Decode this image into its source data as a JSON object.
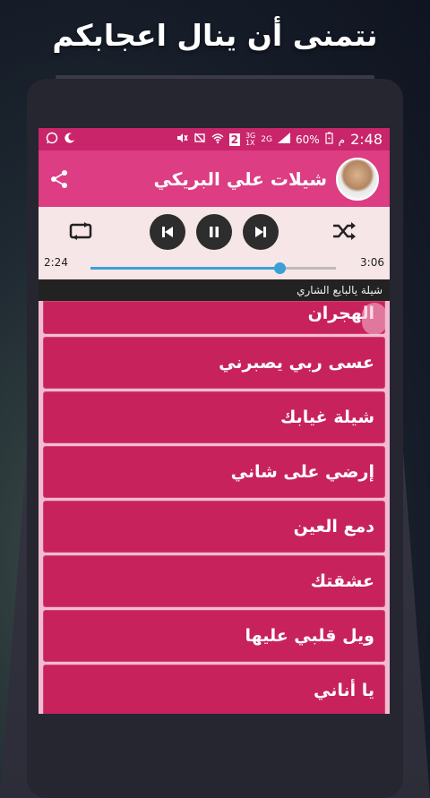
{
  "headline": "نتمنى أن ينال اعجابكم",
  "status_bar": {
    "time": "2:48",
    "am_pm": "م",
    "battery": "60%",
    "network_3g": "3G",
    "network_1x": "1X",
    "network_2g": "2G",
    "sim_slot": "2"
  },
  "app_bar": {
    "title": "شيلات علي البريكي"
  },
  "player": {
    "elapsed": "2:24",
    "duration": "3:06",
    "progress_fraction": 0.77,
    "now_playing": "شيلة يالبايع الشاري"
  },
  "songs": [
    "الهجران",
    "عسى ربي يصبرني",
    "شيلة غيابك",
    "إرضي على شاني",
    "دمع العين",
    "عشقتك",
    "ويل قلبي عليها",
    "يا أناني"
  ],
  "colors": {
    "status_bar": "#c8256a",
    "app_bar": "#dc3d83",
    "row": "#c8225d",
    "progress": "#3aa0d8"
  }
}
